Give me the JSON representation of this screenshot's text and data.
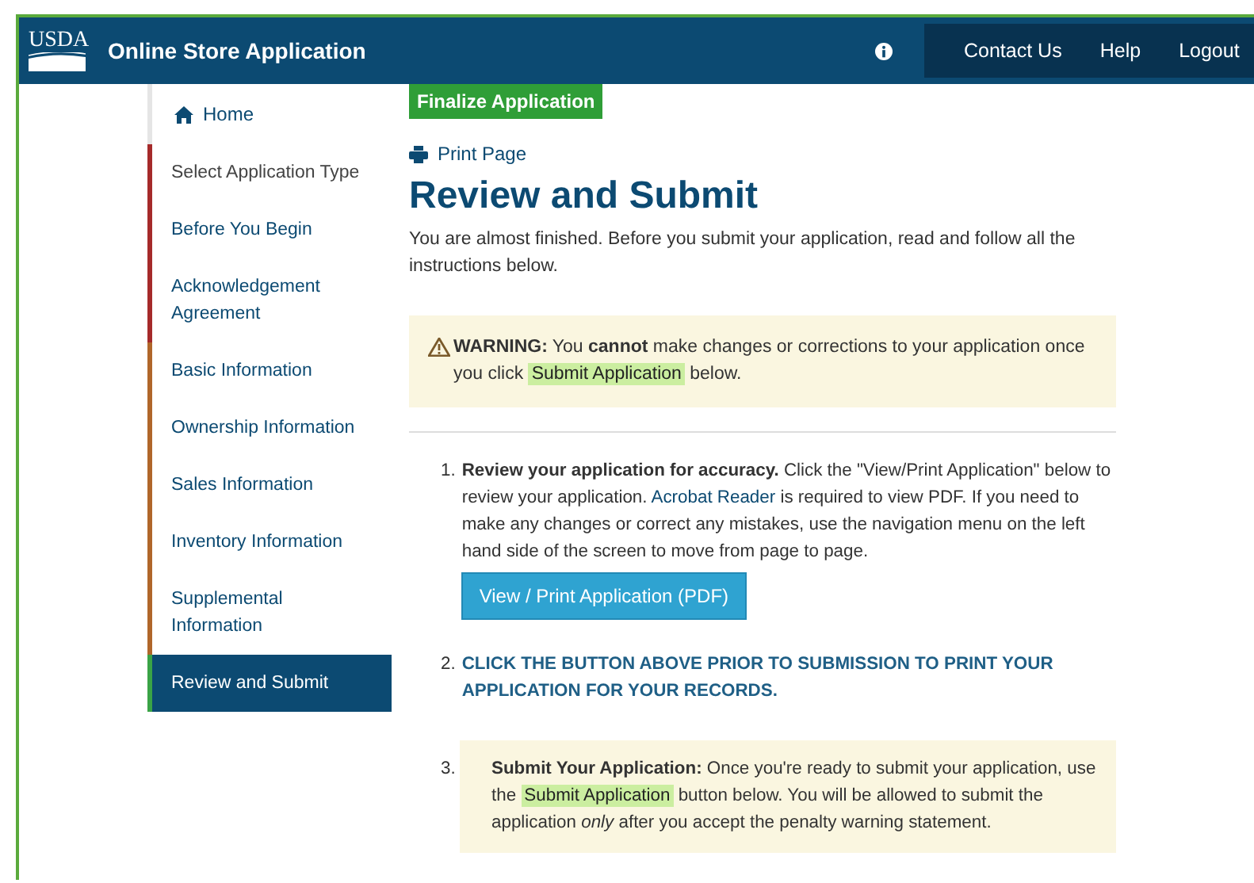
{
  "header": {
    "logo": "USDA",
    "title": "Online Store Application",
    "nav": [
      "Contact Us",
      "Help",
      "Logout"
    ]
  },
  "sidebar": {
    "home": "Home",
    "items": [
      {
        "label": "Select Application Type",
        "color": "#a52a2a",
        "selected": false
      },
      {
        "label": "Before You Begin",
        "color": "#a52a2a",
        "selected": false
      },
      {
        "label": "Acknowledgement Agreement",
        "color": "#a52a2a",
        "selected": false
      },
      {
        "label": "Basic Information",
        "color": "#b0662a",
        "selected": false
      },
      {
        "label": "Ownership Information",
        "color": "#b0662a",
        "selected": false
      },
      {
        "label": "Sales Information",
        "color": "#b0662a",
        "selected": false
      },
      {
        "label": "Inventory Information",
        "color": "#b0662a",
        "selected": false
      },
      {
        "label": "Supplemental Information",
        "color": "#b0662a",
        "selected": false
      },
      {
        "label": "Review and Submit",
        "color": "#3aa346",
        "selected": true
      }
    ]
  },
  "badge": "Finalize Application",
  "print_link": "Print Page",
  "heading": "Review and Submit",
  "intro": "You are almost finished. Before you submit your application, read and follow all the instructions below.",
  "warning": {
    "before": "**WARNING:** You **cannot** make changes or corrections to your application once you click",
    "highlight": "Submit Application",
    "after": "below."
  },
  "steps": [
    {
      "kind": "review",
      "number": "1.",
      "before": "**Review your application for accuracy.** Click the \"View/Print Application\" below to review your application.",
      "link": "Acrobat Reader",
      "after": "is required to view PDF. If you need to make any changes or correct any mistakes, use the navigation menu on the left hand side of the screen to move from page to page.",
      "button": "View / Print Application (PDF)"
    },
    {
      "kind": "notice",
      "number": "2.",
      "text": "CLICK THE BUTTON ABOVE PRIOR TO SUBMISSION TO PRINT YOUR APPLICATION FOR YOUR RECORDS."
    },
    {
      "kind": "submit",
      "number": "3.",
      "before": "**Submit Your Application:** Once you're ready to submit your application, use the",
      "highlight": "Submit Application",
      "after": "button below. You will be allowed to submit the application *only* after you accept the penalty warning statement."
    }
  ]
}
